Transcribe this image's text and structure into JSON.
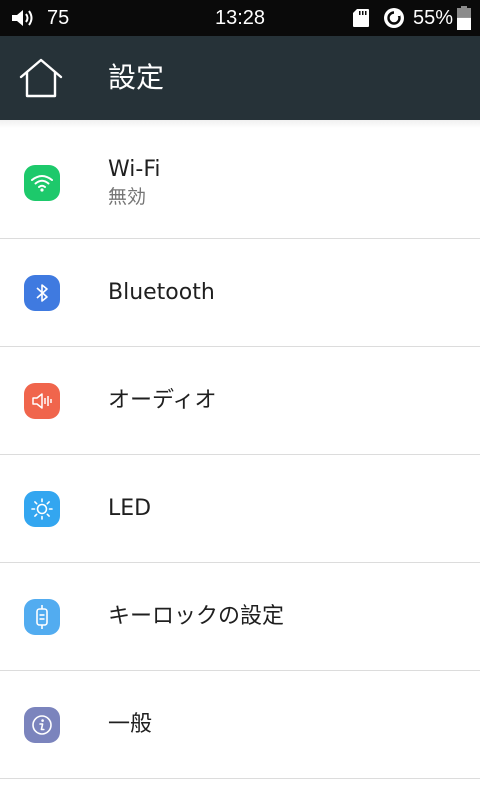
{
  "status_bar": {
    "volume": "75",
    "time": "13:28",
    "battery_percent": "55%",
    "battery_level": 0.55,
    "icons": [
      "volume-icon",
      "sd-card-icon",
      "sync-icon",
      "battery-icon"
    ]
  },
  "app_bar": {
    "title": "設定",
    "home_icon": "home-icon",
    "background_color": "#263238"
  },
  "settings": [
    {
      "label": "Wi-Fi",
      "summary": "無効",
      "icon": "wifi-icon",
      "color": "#1dc96b"
    },
    {
      "label": "Bluetooth",
      "icon": "bluetooth-icon",
      "color": "#3f7ae0"
    },
    {
      "label": "オーディオ",
      "icon": "speaker-icon",
      "color": "#f0654c"
    },
    {
      "label": "LED",
      "icon": "sun-icon",
      "color": "#33a6f0"
    },
    {
      "label": "キーロックの設定",
      "icon": "key-lock-icon",
      "color": "#52acf0"
    },
    {
      "label": "一般",
      "icon": "info-icon",
      "color": "#7b84bd"
    }
  ]
}
